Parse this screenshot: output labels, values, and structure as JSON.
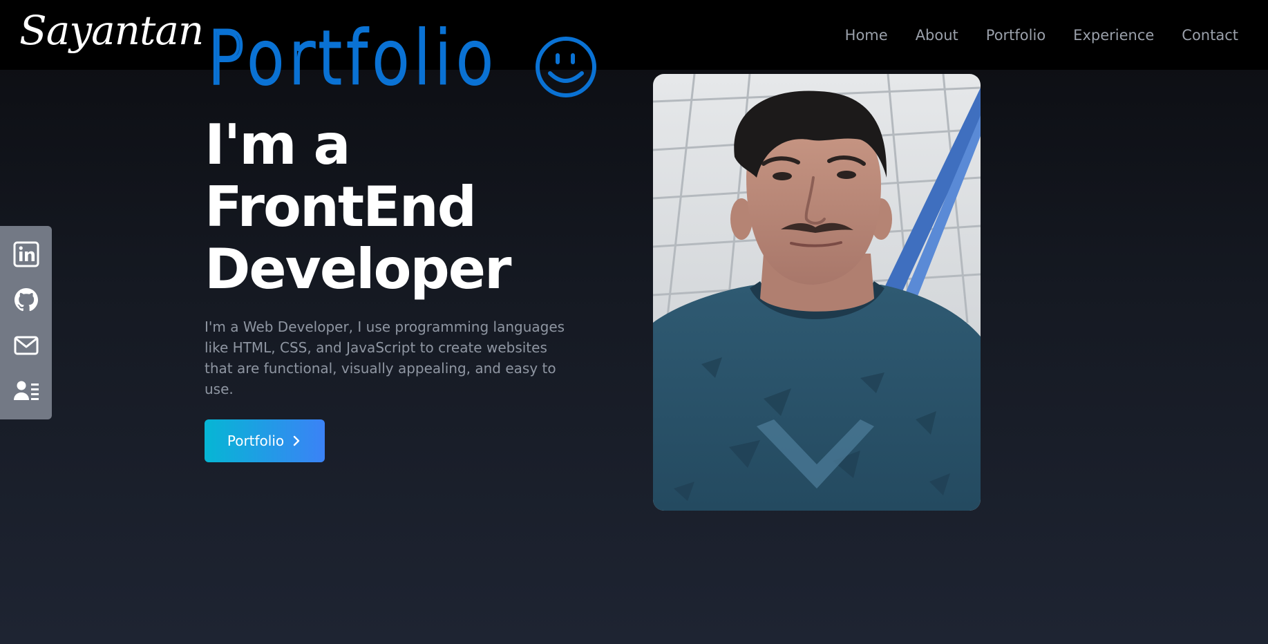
{
  "navbar": {
    "logo": "Sayantan",
    "links": [
      {
        "label": "Home"
      },
      {
        "label": "About"
      },
      {
        "label": "Portfolio"
      },
      {
        "label": "Experience"
      },
      {
        "label": "Contact"
      }
    ]
  },
  "annotation": {
    "text": "Portfolio",
    "color": "#0a72d4",
    "icon": "smiley-face-icon"
  },
  "social": {
    "items": [
      {
        "icon": "linkedin-icon"
      },
      {
        "icon": "github-icon"
      },
      {
        "icon": "mail-icon"
      },
      {
        "icon": "contact-card-icon"
      }
    ]
  },
  "hero": {
    "title_lines": [
      "I'm a",
      "FrontEnd",
      "Developer"
    ],
    "description": "I'm a Web Developer, I use programming languages like HTML, CSS, and JavaScript to create websites that are functional, visually appealing, and easy to use.",
    "cta_label": "Portfolio",
    "cta_icon": "chevron-right-icon"
  },
  "colors": {
    "accent_start": "#06b6d4",
    "accent_end": "#3b82f6",
    "nav_text": "#9aa0aa",
    "body_text": "#8f96a2",
    "sidebar_bg": "#737985"
  }
}
